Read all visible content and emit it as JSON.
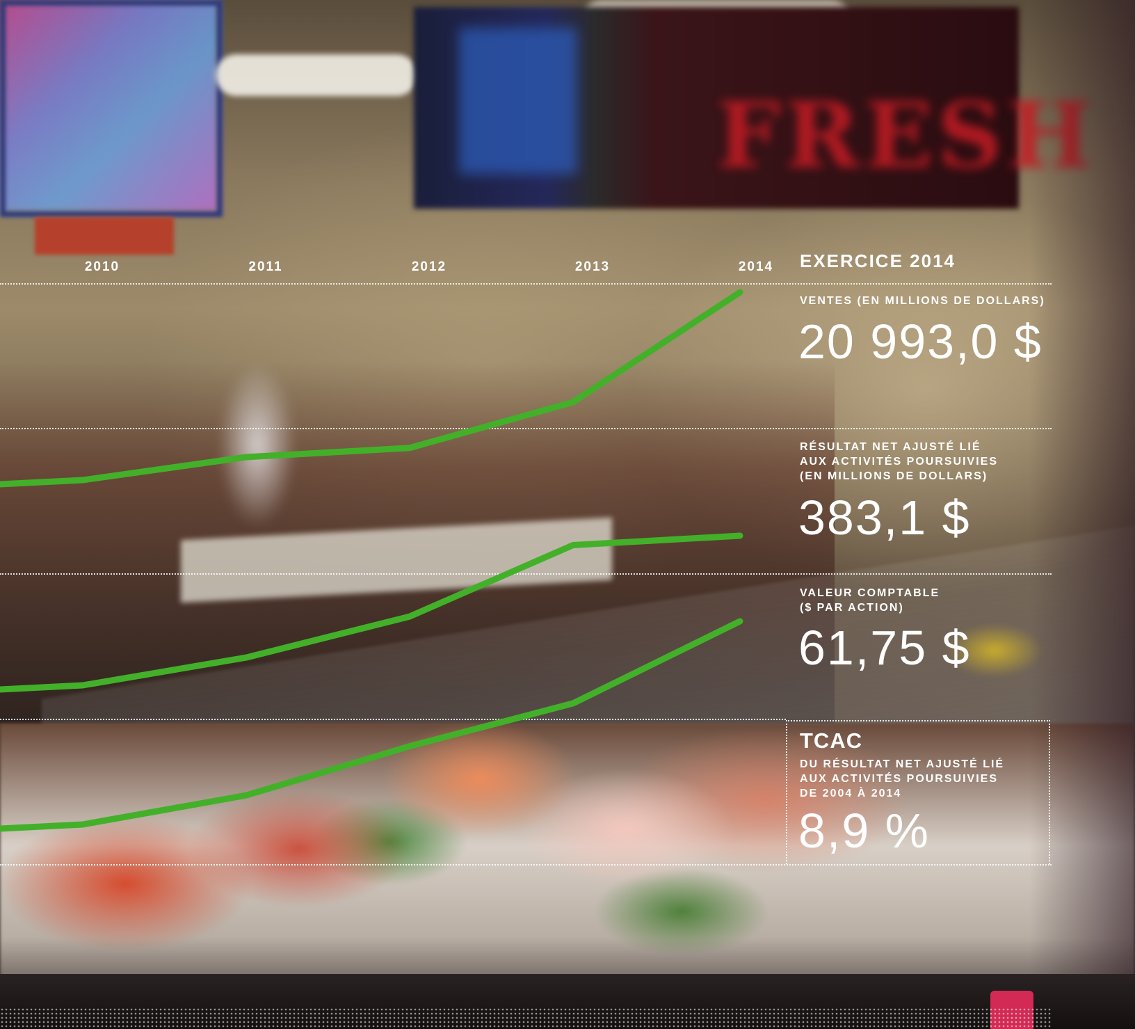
{
  "chart_data": {
    "type": "line",
    "categories": [
      "2010",
      "2011",
      "2012",
      "2013",
      "2014"
    ],
    "series": [
      {
        "values": [
          16.9,
          17.4,
          17.6,
          18.6,
          20.993
        ]
      },
      {
        "values": [
          270,
          291,
          322,
          376,
          383.1
        ]
      },
      {
        "values": [
          48.5,
          50.4,
          53.6,
          56.4,
          61.75
        ]
      }
    ],
    "line_color": "#43b02a"
  },
  "panel": {
    "heading": "EXERCICE 2014",
    "sales_label": "VENTES (EN MILLIONS DE DOLLARS)",
    "sales_value": "20 993,0 $",
    "net_label": "RÉSULTAT NET AJUSTÉ LIÉ\nAUX ACTIVITÉS POURSUIVIES\n(EN MILLIONS DE DOLLARS)",
    "net_value": "383,1 $",
    "book_label": "VALEUR COMPTABLE\n($ PAR ACTION)",
    "book_value": "61,75 $",
    "tcac_heading": "TCAC",
    "tcac_label": "DU RÉSULTAT NET AJUSTÉ LIÉ\nAUX ACTIVITÉS POURSUIVIES\nDE 2004 À 2014",
    "tcac_value": "8,9 %"
  }
}
